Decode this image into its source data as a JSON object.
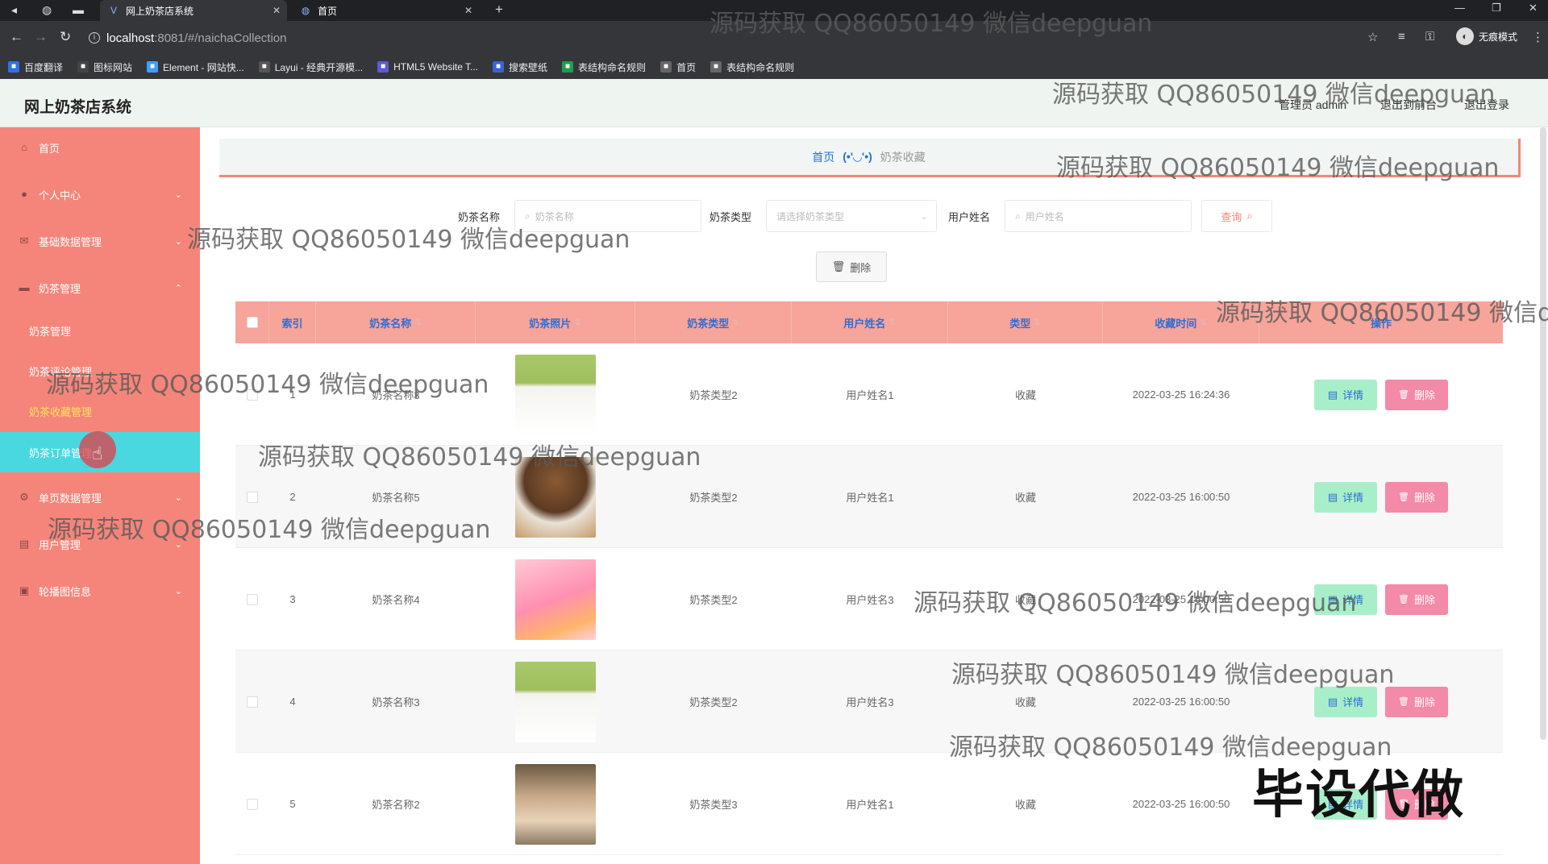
{
  "browser": {
    "tabs": [
      {
        "title": "网上奶茶店系统",
        "active": true
      },
      {
        "title": "首页",
        "active": false
      }
    ],
    "url_host": "localhost",
    "url_path": ":8081/#/naichaCollection",
    "incognito_label": "无痕模式",
    "bookmarks": [
      {
        "label": "百度翻译",
        "color": "#2f72e6"
      },
      {
        "label": "图标网站",
        "color": "#444"
      },
      {
        "label": "Element - 网站快...",
        "color": "#409eff"
      },
      {
        "label": "Layui - 经典开源模...",
        "color": "#555"
      },
      {
        "label": "HTML5 Website T...",
        "color": "#5b5bd6"
      },
      {
        "label": "搜索壁纸",
        "color": "#3a62d8"
      },
      {
        "label": "表结构命名规则",
        "color": "#1e9e4a"
      },
      {
        "label": "首页",
        "color": "#666"
      },
      {
        "label": "表结构命名规则",
        "color": "#666"
      }
    ]
  },
  "header": {
    "app_title": "网上奶茶店系统",
    "admin_label": "管理员 admin",
    "front_link": "退出到前台",
    "logout_link": "退出登录"
  },
  "sidebar": {
    "items": [
      {
        "label": "首页",
        "icon": "home-icon"
      },
      {
        "label": "个人中心",
        "icon": "user-icon"
      },
      {
        "label": "基础数据管理",
        "icon": "mail-icon"
      },
      {
        "label": "奶茶管理",
        "icon": "folder-icon"
      }
    ],
    "sub_items": [
      {
        "label": "奶茶管理"
      },
      {
        "label": "奶茶评论管理"
      },
      {
        "label": "奶茶收藏管理"
      },
      {
        "label": "奶茶订单管理"
      }
    ],
    "items_after": [
      {
        "label": "单页数据管理",
        "icon": "settings-icon"
      },
      {
        "label": "用户管理",
        "icon": "list-icon"
      },
      {
        "label": "轮播图信息",
        "icon": "image-icon"
      }
    ]
  },
  "breadcrumb": {
    "home": "首页",
    "sep": "(•'◡'•)",
    "current": "奶茶收藏"
  },
  "search": {
    "name_label": "奶茶名称",
    "name_placeholder": "奶茶名称",
    "type_label": "奶茶类型",
    "type_placeholder": "请选择奶茶类型",
    "user_label": "用户姓名",
    "user_placeholder": "用户姓名",
    "query_btn": "查询",
    "delete_btn": "删除"
  },
  "table": {
    "columns": [
      "索引",
      "奶茶名称",
      "奶茶照片",
      "奶茶类型",
      "用户姓名",
      "类型",
      "收藏时间",
      "操作"
    ],
    "detail_btn": "详情",
    "delete_btn": "删除",
    "rows": [
      {
        "index": "1",
        "name": "奶茶名称3",
        "type": "奶茶类型2",
        "user": "用户姓名1",
        "kind": "收藏",
        "time": "2022-03-25 16:24:36"
      },
      {
        "index": "2",
        "name": "奶茶名称5",
        "type": "奶茶类型2",
        "user": "用户姓名1",
        "kind": "收藏",
        "time": "2022-03-25 16:00:50"
      },
      {
        "index": "3",
        "name": "奶茶名称4",
        "type": "奶茶类型2",
        "user": "用户姓名3",
        "kind": "收藏",
        "time": "2022-03-25 16:00:50"
      },
      {
        "index": "4",
        "name": "奶茶名称3",
        "type": "奶茶类型2",
        "user": "用户姓名3",
        "kind": "收藏",
        "time": "2022-03-25 16:00:50"
      },
      {
        "index": "5",
        "name": "奶茶名称2",
        "type": "奶茶类型3",
        "user": "用户姓名1",
        "kind": "收藏",
        "time": "2022-03-25 16:00:50"
      }
    ]
  },
  "watermark": {
    "text": "源码获取 QQ86050149 微信deepguan",
    "text_cut": "源码获取 QQ86050149 微信d",
    "big": "毕设代做"
  },
  "colors": {
    "sidebar": "#f5857a",
    "active_sub": "#49d8e0",
    "table_header": "#f7a49a",
    "detail_btn": "#a8efc9",
    "delete_btn": "#f28aa8",
    "link_blue": "#2d6fd4"
  }
}
